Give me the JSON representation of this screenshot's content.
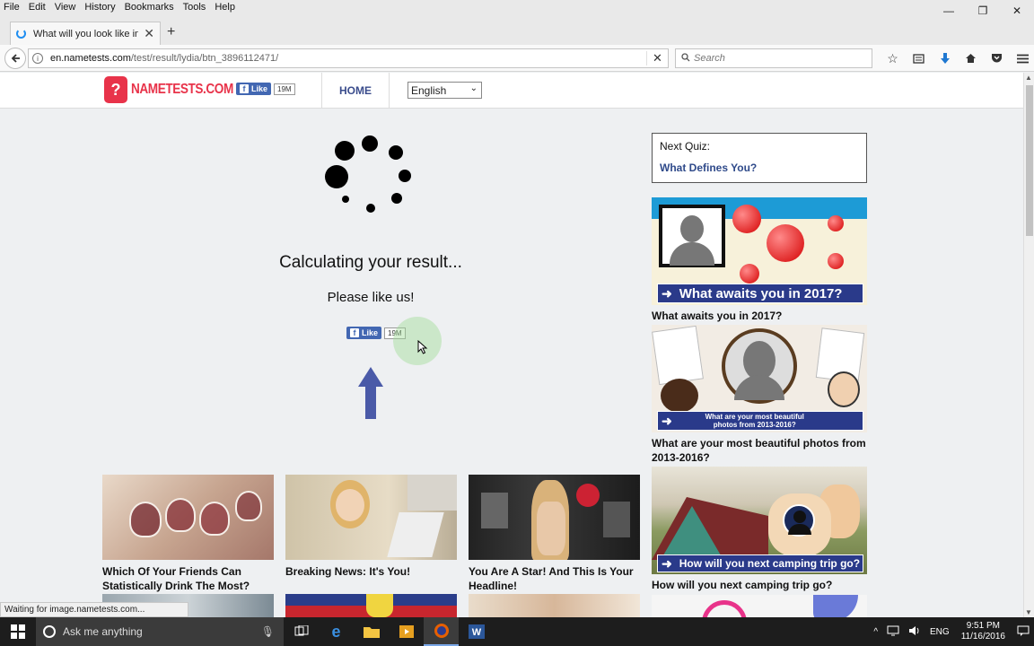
{
  "menubar": {
    "items": [
      "File",
      "Edit",
      "View",
      "History",
      "Bookmarks",
      "Tools",
      "Help"
    ]
  },
  "window_controls": {
    "minimize": "—",
    "restore": "❐",
    "close": "✕"
  },
  "tab": {
    "title": "What will you look like in ...",
    "close": "✕",
    "new_tab": "+"
  },
  "navbar": {
    "url_domain": "en.nametests.com",
    "url_path": "/test/result/lydia/btn_3896112471/",
    "url_clear": "✕",
    "search_placeholder": "Search"
  },
  "site": {
    "logo_text": "NAMETESTS.COM",
    "logo_mark": "?",
    "fb_like": "Like",
    "fb_count": "19M",
    "home": "HOME",
    "language": "English"
  },
  "main": {
    "calculating": "Calculating your result...",
    "please_like": "Please like us!",
    "fb_like": "Like",
    "fb_count": "19M"
  },
  "sidebar": {
    "next_quiz_label": "Next Quiz:",
    "next_quiz_title": "What Defines You?",
    "cards": [
      {
        "banner": "What awaits you in 2017?",
        "caption": "What awaits you in 2017?"
      },
      {
        "banner": "What are your most beautiful photos from 2013-2016?",
        "caption": "What are your most beautiful photos from 2013-2016?"
      },
      {
        "banner": "How will you next camping trip go?",
        "caption": "How will you next camping trip go?"
      }
    ]
  },
  "grid": {
    "cards": [
      {
        "caption": "Which Of Your Friends Can Statistically Drink The Most?"
      },
      {
        "caption": "Breaking News: It's You!"
      },
      {
        "caption": "You Are A Star! And This Is Your Headline!"
      }
    ]
  },
  "status": {
    "text": "Waiting for image.nametests.com..."
  },
  "taskbar": {
    "search": "Ask me anything",
    "lang": "ENG",
    "time": "9:51 PM",
    "date": "11/16/2016"
  },
  "colors": {
    "brand_red": "#e8334a",
    "facebook_blue": "#4267b2",
    "link_blue": "#2f4a8a",
    "banner_navy": "#2a3a8a"
  }
}
